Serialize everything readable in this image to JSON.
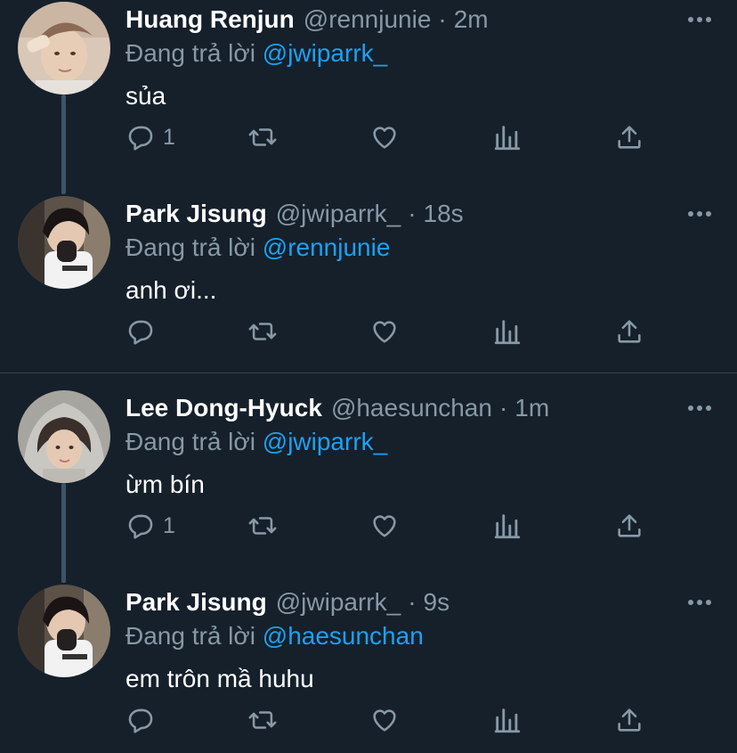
{
  "tweets": [
    {
      "name": "Huang Renjun",
      "handle": "@rennjunie",
      "dot": "·",
      "time": "2m",
      "reply_prefix": "Đang trả lời",
      "reply_to": "@jwiparrk_",
      "text": "sủa",
      "reply_count": "1",
      "avatar": "avatar-renjun"
    },
    {
      "name": "Park Jisung",
      "handle": "@jwiparrk_",
      "dot": "·",
      "time": "18s",
      "reply_prefix": "Đang trả lời",
      "reply_to": "@rennjunie",
      "text": "anh ơi...",
      "reply_count": "",
      "avatar": "avatar-jisung"
    },
    {
      "name": "Lee Dong-Hyuck",
      "handle": "@haesunchan",
      "dot": "·",
      "time": "1m",
      "reply_prefix": "Đang trả lời",
      "reply_to": "@jwiparrk_",
      "text": "ừm bín",
      "reply_count": "1",
      "avatar": "avatar-donghyuck"
    },
    {
      "name": "Park Jisung",
      "handle": "@jwiparrk_",
      "dot": "·",
      "time": "9s",
      "reply_prefix": "Đang trả lời",
      "reply_to": "@haesunchan",
      "text": "em trôn mầ huhu",
      "reply_count": "",
      "avatar": "avatar-jisung"
    }
  ],
  "icons": {
    "reply": "reply-icon",
    "retweet": "retweet-icon",
    "like": "heart-icon",
    "analytics": "analytics-icon",
    "share": "share-icon",
    "more": "more-icon"
  },
  "colors": {
    "background": "#15202b",
    "secondary_text": "#8899a6",
    "mention": "#1da1f2",
    "thread_line": "#3d5466",
    "divider": "#38444d"
  }
}
